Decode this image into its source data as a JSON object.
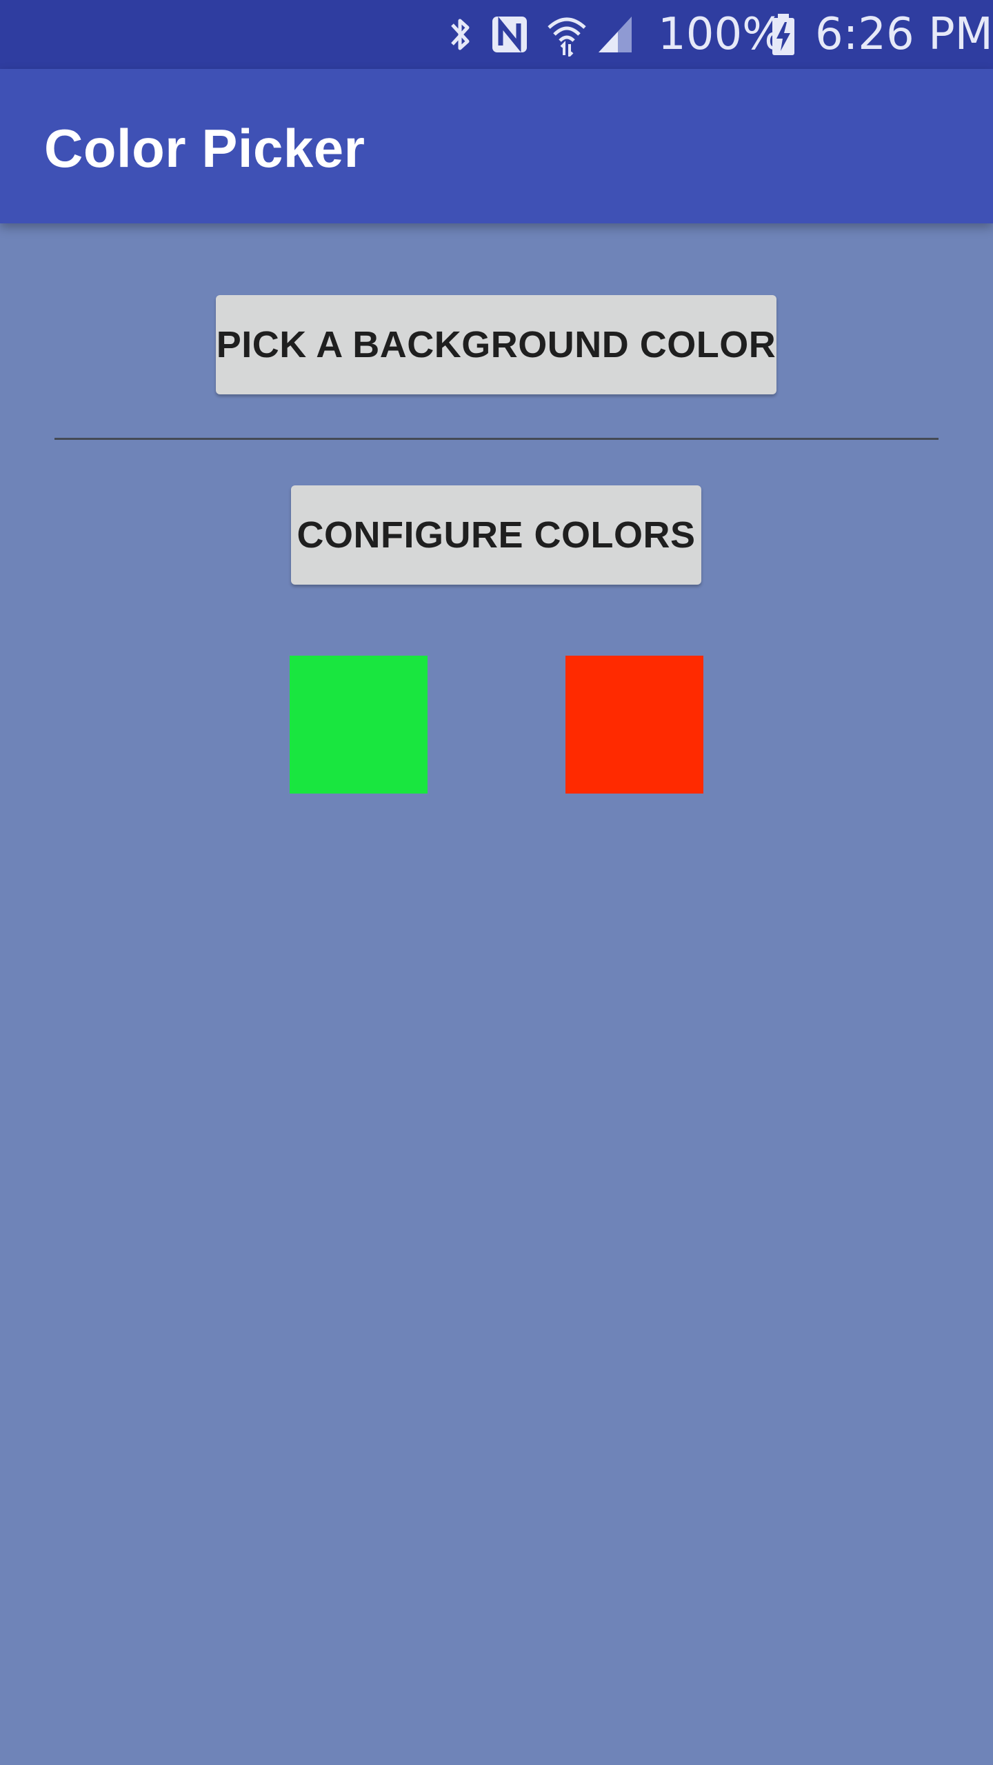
{
  "status_bar": {
    "battery_percent": "100%",
    "time": "6:26 PM",
    "icons": [
      "bluetooth-icon",
      "nfc-icon",
      "wifi-icon",
      "signal-icon",
      "battery-charging-icon"
    ]
  },
  "app_bar": {
    "title": "Color Picker"
  },
  "main": {
    "pick_background_label": "PICK A BACKGROUND COLOR",
    "configure_colors_label": "CONFIGURE COLORS",
    "swatches": [
      {
        "name": "green",
        "color": "#19e63f"
      },
      {
        "name": "red",
        "color": "#ff2a00"
      }
    ]
  },
  "colors": {
    "status_bar": "#2f3da0",
    "app_bar": "#3f51b5",
    "background": "#6f84b8",
    "button": "#d6d7d7"
  }
}
